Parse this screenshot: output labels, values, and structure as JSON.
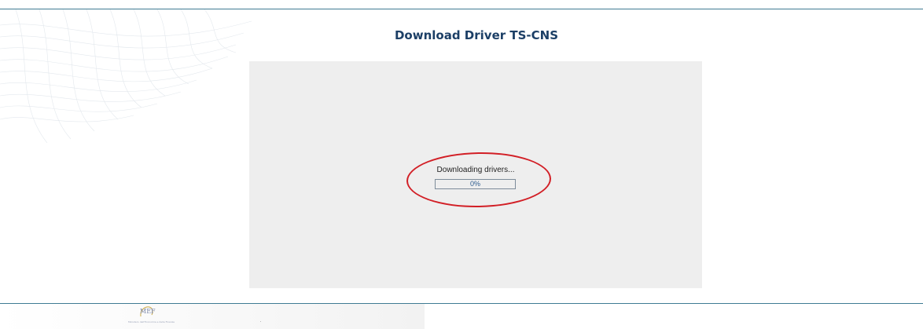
{
  "header": {
    "title": "Download Driver TS-CNS"
  },
  "applet": {
    "status_text": "Downloading drivers...",
    "progress": {
      "fraction": 0,
      "label": "0%"
    }
  },
  "footer": {
    "logo_text": "MEF",
    "logo_caption": "Ministero dell'Economia e delle Finanze"
  },
  "colors": {
    "title": "#1c3f66",
    "rule": "#3f7b93",
    "panel_bg": "#eeeeee",
    "highlight": "#d21f26",
    "progress_text": "#2d5c8f"
  }
}
